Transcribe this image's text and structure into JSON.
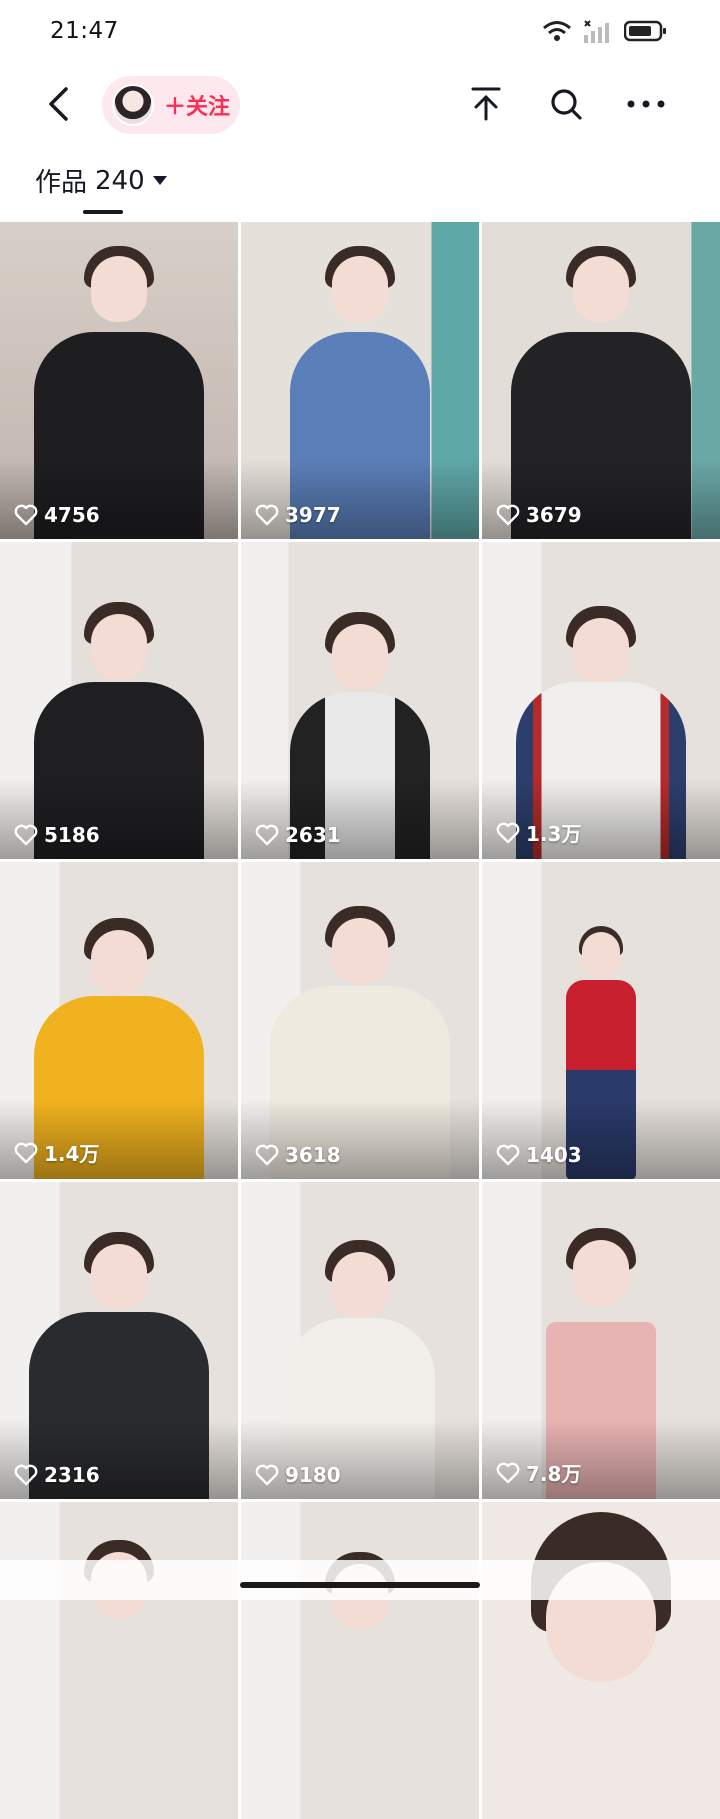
{
  "status": {
    "time": "21:47"
  },
  "header": {
    "follow_label": "＋关注",
    "icons": [
      "back-icon",
      "scroll-to-top-icon",
      "search-icon",
      "more-icon"
    ]
  },
  "tabs": {
    "works_label": "作品",
    "works_count": "240"
  },
  "colors": {
    "accent": "#fe2c55",
    "pill_bg": "#fde8ee"
  },
  "posts": [
    {
      "likes": "4756"
    },
    {
      "likes": "3977"
    },
    {
      "likes": "3679"
    },
    {
      "likes": "5186"
    },
    {
      "likes": "2631"
    },
    {
      "likes": "1.3万"
    },
    {
      "likes": "1.4万"
    },
    {
      "likes": "3618"
    },
    {
      "likes": "1403"
    },
    {
      "likes": "2316"
    },
    {
      "likes": "9180"
    },
    {
      "likes": "7.8万"
    },
    {
      "likes": ""
    },
    {
      "likes": ""
    },
    {
      "likes": ""
    }
  ]
}
